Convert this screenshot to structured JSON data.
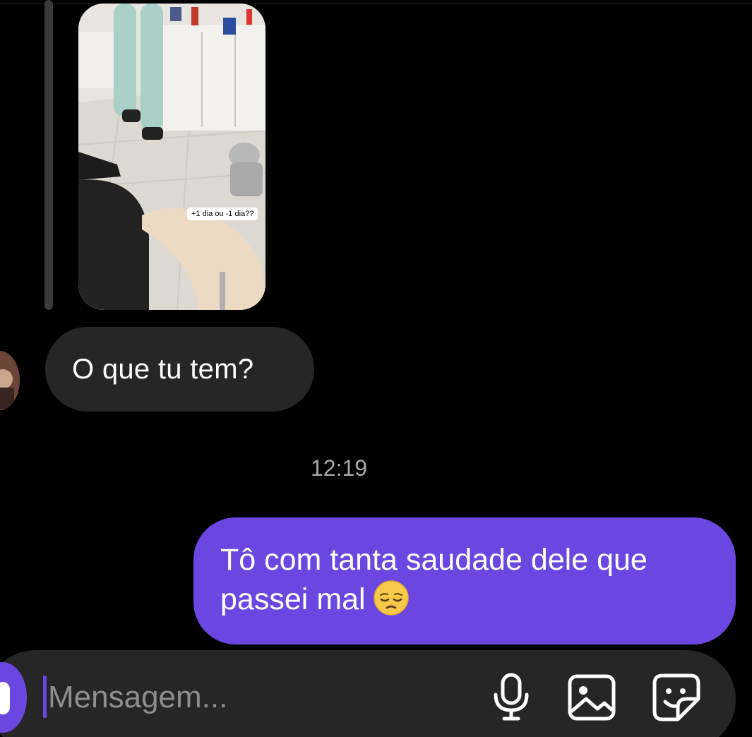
{
  "thread": {
    "story_reply": {
      "caption": "+1 dia ou -1 dia??"
    },
    "incoming_message": {
      "text": "O que tu tem?"
    },
    "timestamp": "12:19",
    "outgoing_message": {
      "line1": "Tô com tanta saudade dele que",
      "line2": "passei mal",
      "emoji": "pensive-face"
    }
  },
  "composer": {
    "placeholder": "Mensagem...",
    "value": "",
    "icons": [
      "camera-icon",
      "microphone-icon",
      "gallery-icon",
      "sticker-icon"
    ]
  },
  "colors": {
    "background": "#000000",
    "incoming_bubble": "#262626",
    "outgoing_bubble": "#6b46e0",
    "timestamp": "#a8a8a8",
    "placeholder": "#8e8e8e"
  }
}
